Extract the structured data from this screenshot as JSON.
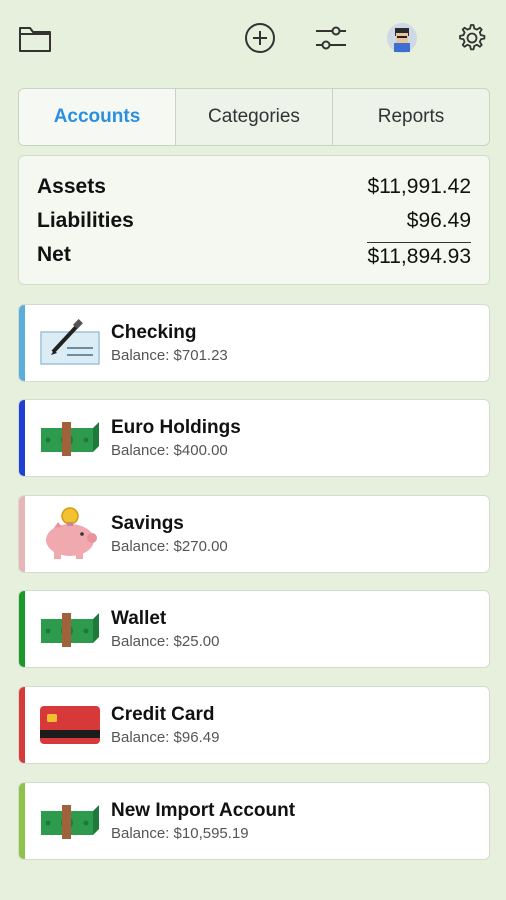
{
  "toolbar": {
    "icons": [
      "folder-icon",
      "add-icon",
      "sliders-icon",
      "avatar",
      "gear-icon"
    ]
  },
  "tabs": [
    {
      "label": "Accounts",
      "active": true
    },
    {
      "label": "Categories",
      "active": false
    },
    {
      "label": "Reports",
      "active": false
    }
  ],
  "summary": {
    "assets_label": "Assets",
    "assets_value": "$11,991.42",
    "liabilities_label": "Liabilities",
    "liabilities_value": "$96.49",
    "net_label": "Net",
    "net_value": "$11,894.93"
  },
  "accounts": [
    {
      "name": "Checking",
      "balance": "Balance: $701.23",
      "icon": "check-icon",
      "color": "#5aaed9"
    },
    {
      "name": "Euro Holdings",
      "balance": "Balance: $400.00",
      "icon": "cash-icon",
      "color": "#1f3fd6"
    },
    {
      "name": "Savings",
      "balance": "Balance: $270.00",
      "icon": "piggy-bank-icon",
      "color": "#e8b6b6"
    },
    {
      "name": "Wallet",
      "balance": "Balance: $25.00",
      "icon": "cash-icon",
      "color": "#1a9a2a"
    },
    {
      "name": "Credit Card",
      "balance": "Balance: $96.49",
      "icon": "credit-card-icon",
      "color": "#d83a3a"
    },
    {
      "name": "New Import Account",
      "balance": "Balance: $10,595.19",
      "icon": "cash-icon",
      "color": "#8cc44a"
    }
  ],
  "colors": {
    "background": "#e6f0dc",
    "accent": "#2b8fe0"
  }
}
